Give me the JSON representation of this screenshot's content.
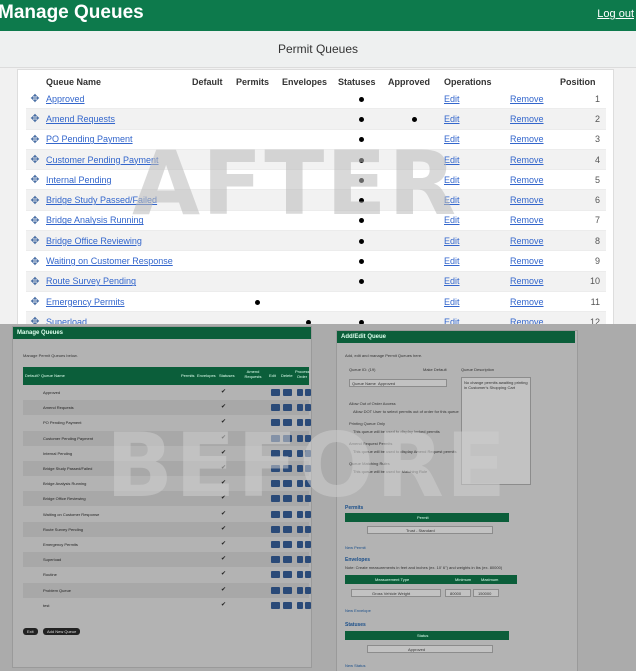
{
  "header": {
    "title": "Manage Queues",
    "logout": "Log out"
  },
  "subheader": {
    "title": "Permit Queues"
  },
  "table": {
    "columns": [
      "Queue Name",
      "Default",
      "Permits",
      "Envelopes",
      "Statuses",
      "Approved",
      "Operations",
      "Position"
    ],
    "edit_label": "Edit",
    "remove_label": "Remove",
    "rows": [
      {
        "name": "Approved",
        "default": false,
        "permits": false,
        "envelopes": false,
        "statuses": true,
        "approved": false,
        "position": "1"
      },
      {
        "name": "Amend Requests",
        "default": false,
        "permits": false,
        "envelopes": false,
        "statuses": true,
        "approved": true,
        "position": "2"
      },
      {
        "name": "PO Pending Payment",
        "default": false,
        "permits": false,
        "envelopes": false,
        "statuses": true,
        "approved": false,
        "position": "3"
      },
      {
        "name": "Customer Pending Payment",
        "default": false,
        "permits": false,
        "envelopes": false,
        "statuses": true,
        "approved": false,
        "position": "4"
      },
      {
        "name": "Internal Pending",
        "default": false,
        "permits": false,
        "envelopes": false,
        "statuses": true,
        "approved": false,
        "position": "5"
      },
      {
        "name": "Bridge Study Passed/Failed",
        "default": false,
        "permits": false,
        "envelopes": false,
        "statuses": true,
        "approved": false,
        "position": "6"
      },
      {
        "name": "Bridge Analysis Running",
        "default": false,
        "permits": false,
        "envelopes": false,
        "statuses": true,
        "approved": false,
        "position": "7"
      },
      {
        "name": "Bridge Office Reviewing",
        "default": false,
        "permits": false,
        "envelopes": false,
        "statuses": true,
        "approved": false,
        "position": "8"
      },
      {
        "name": "Waiting on Customer Response",
        "default": false,
        "permits": false,
        "envelopes": false,
        "statuses": true,
        "approved": false,
        "position": "9"
      },
      {
        "name": "Route Survey Pending",
        "default": false,
        "permits": false,
        "envelopes": false,
        "statuses": true,
        "approved": false,
        "position": "10"
      },
      {
        "name": "Emergency Permits",
        "default": false,
        "permits": true,
        "envelopes": false,
        "statuses": false,
        "approved": false,
        "position": "11"
      },
      {
        "name": "Superload",
        "default": false,
        "permits": false,
        "envelopes": true,
        "statuses": true,
        "approved": false,
        "position": "12"
      }
    ]
  },
  "watermarks": {
    "after": "AFTER",
    "before": "BEFORE"
  },
  "before": {
    "left_title": "Manage Queues",
    "left_intro": "Manage Permit Queues below.",
    "left_headers": [
      "Default?",
      "Queue Name",
      "Permits",
      "Envelopes",
      "Statuses",
      "Amend Requests",
      "Edit",
      "Delete",
      "Process Order"
    ],
    "left_rows": [
      "Approved",
      "Amend Requests",
      "PO Pending Payment",
      "Customer Pending Payment",
      "Internal Pending",
      "Bridge Study Passed/Failed",
      "Bridge Analysis Running",
      "Bridge Office Reviewing",
      "Waiting on Customer Response",
      "Route Survey Pending",
      "Emergency Permits",
      "Superload",
      "Routine",
      "Problem Queue",
      "test"
    ],
    "exit_btn": "Exit",
    "add_btn": "Add New Queue",
    "right_title": "Add/Edit Queue",
    "right_intro": "Add, edit and manage Permit Queues here.",
    "queue_id_label": "Queue ID: (19)",
    "make_default_label": "Make Default",
    "queue_desc_label": "Queue Description",
    "queue_name_label": "Queue Name",
    "queue_name_value": "Approved",
    "queue_desc_value": "No change permits awaiting printing in Customer's Shopping Cart",
    "allow_label": "Allow Out of Order Access",
    "allow_text": "Allow DOT User to select permits out of order for this queue",
    "printing_label": "Printing Queue Only",
    "printing_text": "This queue will be used to display locked permits",
    "amend_label": "Amend Request Permits",
    "amend_text": "This queue will be used to display Amend Request permits",
    "queue_matching_label": "Queue Matching Rules",
    "queue_matching_text": "This queue will be used for Matching Rule",
    "permits_title": "Permits",
    "permits_col": "Permit",
    "permits_value": "Trust - Standard",
    "new_permit": "New Permit",
    "envelopes_title": "Envelopes",
    "envelopes_note": "Note: Create measurements in feet and inches (ex. 10' 6\") and weights in lbs (ex. 80000)",
    "env_cols": [
      "Measurement Type",
      "Minimum",
      "Maximum"
    ],
    "env_type": "Gross Vehicle Weight",
    "env_min": "80000",
    "env_max": "150000",
    "new_envelope": "New Envelope",
    "statuses_title": "Statuses",
    "status_col": "Status",
    "status_value": "Approved",
    "new_status": "New Status"
  }
}
